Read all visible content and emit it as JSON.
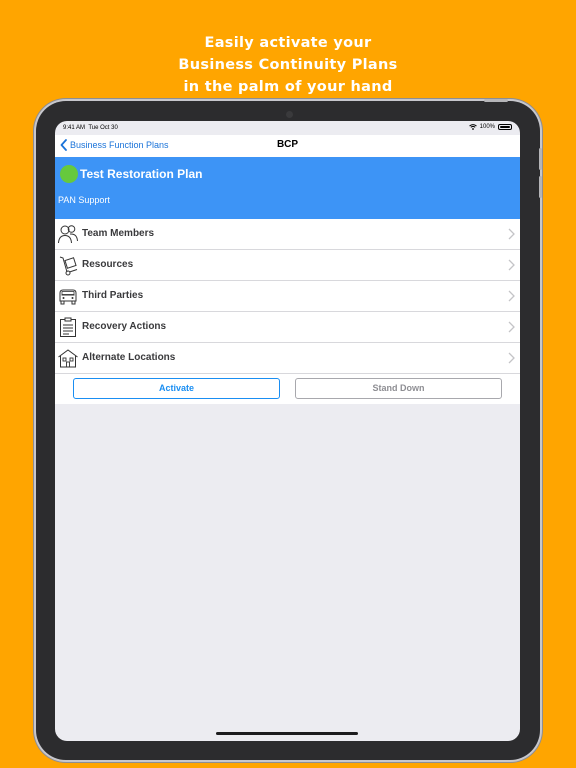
{
  "promo": {
    "line1": "Easily activate your",
    "line2": "Business Continuity Plans",
    "line3": "in the palm of your hand"
  },
  "status_bar": {
    "time": "9:41 AM",
    "date": "Tue Oct 30",
    "battery": "100%"
  },
  "nav": {
    "back_label": "Business Function Plans",
    "title": "BCP"
  },
  "plan": {
    "title": "Test Restoration Plan",
    "subtitle": "PAN Support",
    "status_color": "#66c93d"
  },
  "menu": [
    {
      "label": "Team Members",
      "icon": "team-members-icon"
    },
    {
      "label": "Resources",
      "icon": "hand-truck-icon"
    },
    {
      "label": "Third Parties",
      "icon": "van-icon"
    },
    {
      "label": "Recovery Actions",
      "icon": "clipboard-icon"
    },
    {
      "label": "Alternate Locations",
      "icon": "building-icon"
    }
  ],
  "actions": {
    "activate": "Activate",
    "stand_down": "Stand Down"
  },
  "colors": {
    "background": "#FFA500",
    "header_blue": "#3d94f6",
    "accent_blue": "#1a8ef2"
  }
}
